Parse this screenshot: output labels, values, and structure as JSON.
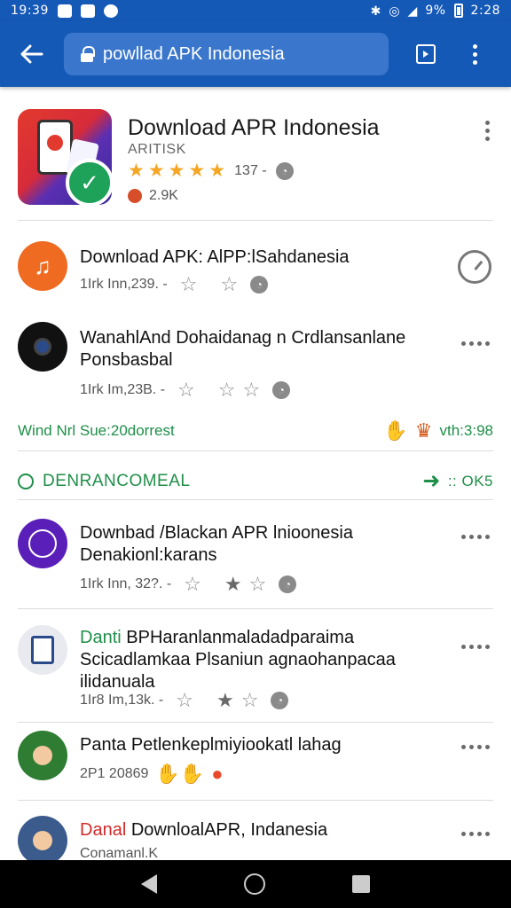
{
  "status_bar": {
    "time_left": "19:39",
    "time_right": "2:28",
    "battery_text": "9%"
  },
  "toolbar": {
    "url": "powllad APK Indonesia"
  },
  "hero": {
    "title": "Download APR Indonesia",
    "subtitle": "ARITISK",
    "rating_count": "137 -",
    "downloads": "2.9K",
    "icon_color": "#e23a2e",
    "badge_color": "#1ea25a"
  },
  "items": [
    {
      "title": "Download APK: AlPP:lSahdanesia",
      "meta": "1Irk Inn,239. -",
      "avatar_color": "#f06b22",
      "avatar_icon": "music-note-icon"
    },
    {
      "title": "WanahlAnd Dohaidanag n Crdlansanlane Ponsbasbal",
      "meta": "1Irk Im,23B. -",
      "avatar_color": "#111111",
      "avatar_icon": "camera-lens-icon"
    },
    {
      "title": "Downbad /Blackan APR lnioonesia Denakionl:karans",
      "meta": "1Irk Inn, 32?. -",
      "avatar_color": "#5a1fb8",
      "avatar_icon": "face-circle-icon"
    },
    {
      "title_accent": "Danti",
      "title": " BPHaranlanmaladadparaima Scicadlamkaa Plsaniun agnaohanpacaa ilidanuala",
      "meta": "1Ir8 Im,13k. -",
      "avatar_color": "#e8eaf0",
      "avatar_icon": "document-icon"
    },
    {
      "title": "Panta Petlenkeplmiyiookatl lahag",
      "meta": "2P1 20869",
      "avatar_color": "#2e7d32",
      "avatar_icon": "person-photo-icon"
    },
    {
      "title_accent": "Danal",
      "title": " DownloalAPR, Indanesia",
      "meta": "Conamanl.K",
      "avatar_color": "#3b5b8c",
      "avatar_icon": "person-photo-icon"
    }
  ],
  "promo": {
    "left": "Wind Nrl Sue:20dorrest",
    "right": "vth:3:98"
  },
  "section": {
    "label": "DENRANCOMEAL",
    "right": ":: OK5"
  },
  "colors": {
    "brand_blue": "#1559b6",
    "accent_green": "#1f8f49",
    "star_gold": "#f5a623"
  }
}
